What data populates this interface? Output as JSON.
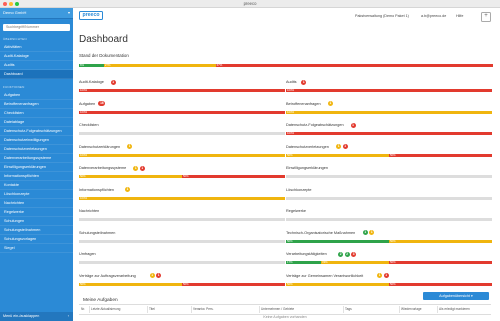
{
  "window": {
    "title": "preeco"
  },
  "sidebar": {
    "org": "Demo GmbH",
    "search_placeholder": "Suchbegriff/Nummer",
    "section1": "Übersichten",
    "items1": [
      "Aktivitäten",
      "Audit-Kataloge",
      "Audits",
      "Dashboard"
    ],
    "section2": "Funktionen",
    "items2": [
      "Aufgaben",
      "Betroffenenanfragen",
      "Checklisten",
      "Dateiablage",
      "Datenschutz-Folgeabschätzungen",
      "Datenschutzeinwilligungen",
      "Datenschutzverletzungen",
      "Datenverarbeitungssysteme",
      "Einwilligungserklärungen",
      "Informationspflichten",
      "Kontakte",
      "Löschkonzepte",
      "Nachrichten",
      "Regelwerke",
      "Schulungen",
      "Schulungsteilnahmen",
      "Schulungsvorlagen",
      "Siegel"
    ],
    "active": "Dashboard",
    "footer": "Menü ein-/ausklappen"
  },
  "header": {
    "logo": "preeco",
    "org": "Pakstverwaltung (Demo Paket 1)",
    "user": "a.b@preeco.de",
    "lang": "Hilfe",
    "plus": "+"
  },
  "page": {
    "title": "Dashboard"
  },
  "overall": {
    "title": "Stand der Dokumentation",
    "segments": [
      {
        "pct": 6,
        "label": "6%",
        "color": "#2fa34a"
      },
      {
        "pct": 27,
        "label": "27%",
        "color": "#f0b50f"
      },
      {
        "pct": 67,
        "label": "67%",
        "color": "#e23a2e"
      }
    ]
  },
  "colors": {
    "red": "#e23a2e",
    "yellow": "#f0b50f",
    "green": "#2fa34a",
    "gray": "#d9d9d9",
    "accent": "#2b8ad6"
  },
  "categories_left": [
    {
      "name": "Audit-Kataloge",
      "badges": [
        {
          "c": "red",
          "t": "1"
        }
      ],
      "segments": [
        {
          "pct": 100,
          "label": "100%",
          "color": "#e23a2e"
        }
      ]
    },
    {
      "name": "Aufgaben",
      "badges": [
        {
          "c": "red",
          "t": "16"
        }
      ],
      "segments": [
        {
          "pct": 100,
          "label": "100%",
          "color": "#e23a2e"
        }
      ]
    },
    {
      "name": "Checklisten",
      "badges": [],
      "segments": []
    },
    {
      "name": "Datenschutzerklärungen",
      "badges": [
        {
          "c": "yellow",
          "t": "1"
        }
      ],
      "segments": [
        {
          "pct": 100,
          "label": "100%",
          "color": "#f0b50f"
        }
      ]
    },
    {
      "name": "Datenverarbeitungssysteme",
      "badges": [
        {
          "c": "yellow",
          "t": "1"
        },
        {
          "c": "red",
          "t": "1"
        }
      ],
      "segments": [
        {
          "pct": 50,
          "label": "50%",
          "color": "#f0b50f"
        },
        {
          "pct": 50,
          "label": "50%",
          "color": "#e23a2e"
        }
      ]
    },
    {
      "name": "Informationspflichten",
      "badges": [
        {
          "c": "yellow",
          "t": "1"
        }
      ],
      "segments": [
        {
          "pct": 100,
          "label": "100%",
          "color": "#f0b50f"
        }
      ]
    },
    {
      "name": "Nachrichten",
      "badges": [],
      "segments": []
    },
    {
      "name": "Schulungsteilnahmen",
      "badges": [],
      "segments": []
    },
    {
      "name": "Umfragen",
      "badges": [],
      "segments": []
    },
    {
      "name": "Verträge zur Auftragsverarbeitung",
      "badges": [
        {
          "c": "yellow",
          "t": "1"
        },
        {
          "c": "red",
          "t": "1"
        }
      ],
      "segments": [
        {
          "pct": 50,
          "label": "50%",
          "color": "#f0b50f"
        },
        {
          "pct": 50,
          "label": "50%",
          "color": "#e23a2e"
        }
      ]
    }
  ],
  "categories_right": [
    {
      "name": "Audits",
      "badges": [
        {
          "c": "red",
          "t": "1"
        }
      ],
      "segments": [
        {
          "pct": 100,
          "label": "100%",
          "color": "#e23a2e"
        }
      ]
    },
    {
      "name": "Betroffenenanfragen",
      "badges": [
        {
          "c": "yellow",
          "t": "1"
        }
      ],
      "segments": [
        {
          "pct": 100,
          "label": "100%",
          "color": "#f0b50f"
        }
      ]
    },
    {
      "name": "Datenschutz-Folgeabschätzungen",
      "badges": [
        {
          "c": "red",
          "t": "1"
        }
      ],
      "segments": [
        {
          "pct": 100,
          "label": "100%",
          "color": "#e23a2e"
        }
      ]
    },
    {
      "name": "Datenschutzverletzungen",
      "badges": [
        {
          "c": "yellow",
          "t": "1"
        },
        {
          "c": "red",
          "t": "1"
        }
      ],
      "segments": [
        {
          "pct": 50,
          "label": "50%",
          "color": "#f0b50f"
        },
        {
          "pct": 50,
          "label": "50%",
          "color": "#e23a2e"
        }
      ]
    },
    {
      "name": "Einwilligungserklärungen",
      "badges": [],
      "segments": []
    },
    {
      "name": "Löschkonzepte",
      "badges": [],
      "segments": []
    },
    {
      "name": "Regelwerke",
      "badges": [],
      "segments": []
    },
    {
      "name": "Technisch-Organisatorische Maßnahmen",
      "badges": [
        {
          "c": "green",
          "t": "1"
        },
        {
          "c": "yellow",
          "t": "1"
        }
      ],
      "segments": [
        {
          "pct": 50,
          "label": "50%",
          "color": "#2fa34a"
        },
        {
          "pct": 50,
          "label": "50%",
          "color": "#f0b50f"
        }
      ]
    },
    {
      "name": "Verarbeitungstätigkeiten",
      "badges": [
        {
          "c": "green",
          "t": "2"
        },
        {
          "c": "green",
          "t": "2"
        },
        {
          "c": "red",
          "t": "3"
        }
      ],
      "segments": [
        {
          "pct": 17,
          "label": "17%",
          "color": "#2fa34a"
        },
        {
          "pct": 33,
          "label": "33%",
          "color": "#f0b50f"
        },
        {
          "pct": 50,
          "label": "50%",
          "color": "#e23a2e"
        }
      ]
    },
    {
      "name": "Verträge zur Gemeinsamen Verantwortlichkeit",
      "badges": [
        {
          "c": "yellow",
          "t": "1"
        },
        {
          "c": "red",
          "t": "1"
        }
      ],
      "segments": [
        {
          "pct": 50,
          "label": "50%",
          "color": "#f0b50f"
        },
        {
          "pct": 50,
          "label": "50%",
          "color": "#e23a2e"
        }
      ]
    }
  ],
  "tasks": {
    "title": "Meine Aufgaben",
    "button": "Aufgabenübersicht ▾",
    "columns": [
      "Nr.",
      "Letzte Aktualisierung",
      "Titel",
      "Verantw. Pers.",
      "Unternehmen / Gebiete",
      "Tags",
      "Wiedervorlage",
      "Als erledigt markieren"
    ],
    "empty": "Keine Aufgaben vorhanden"
  }
}
